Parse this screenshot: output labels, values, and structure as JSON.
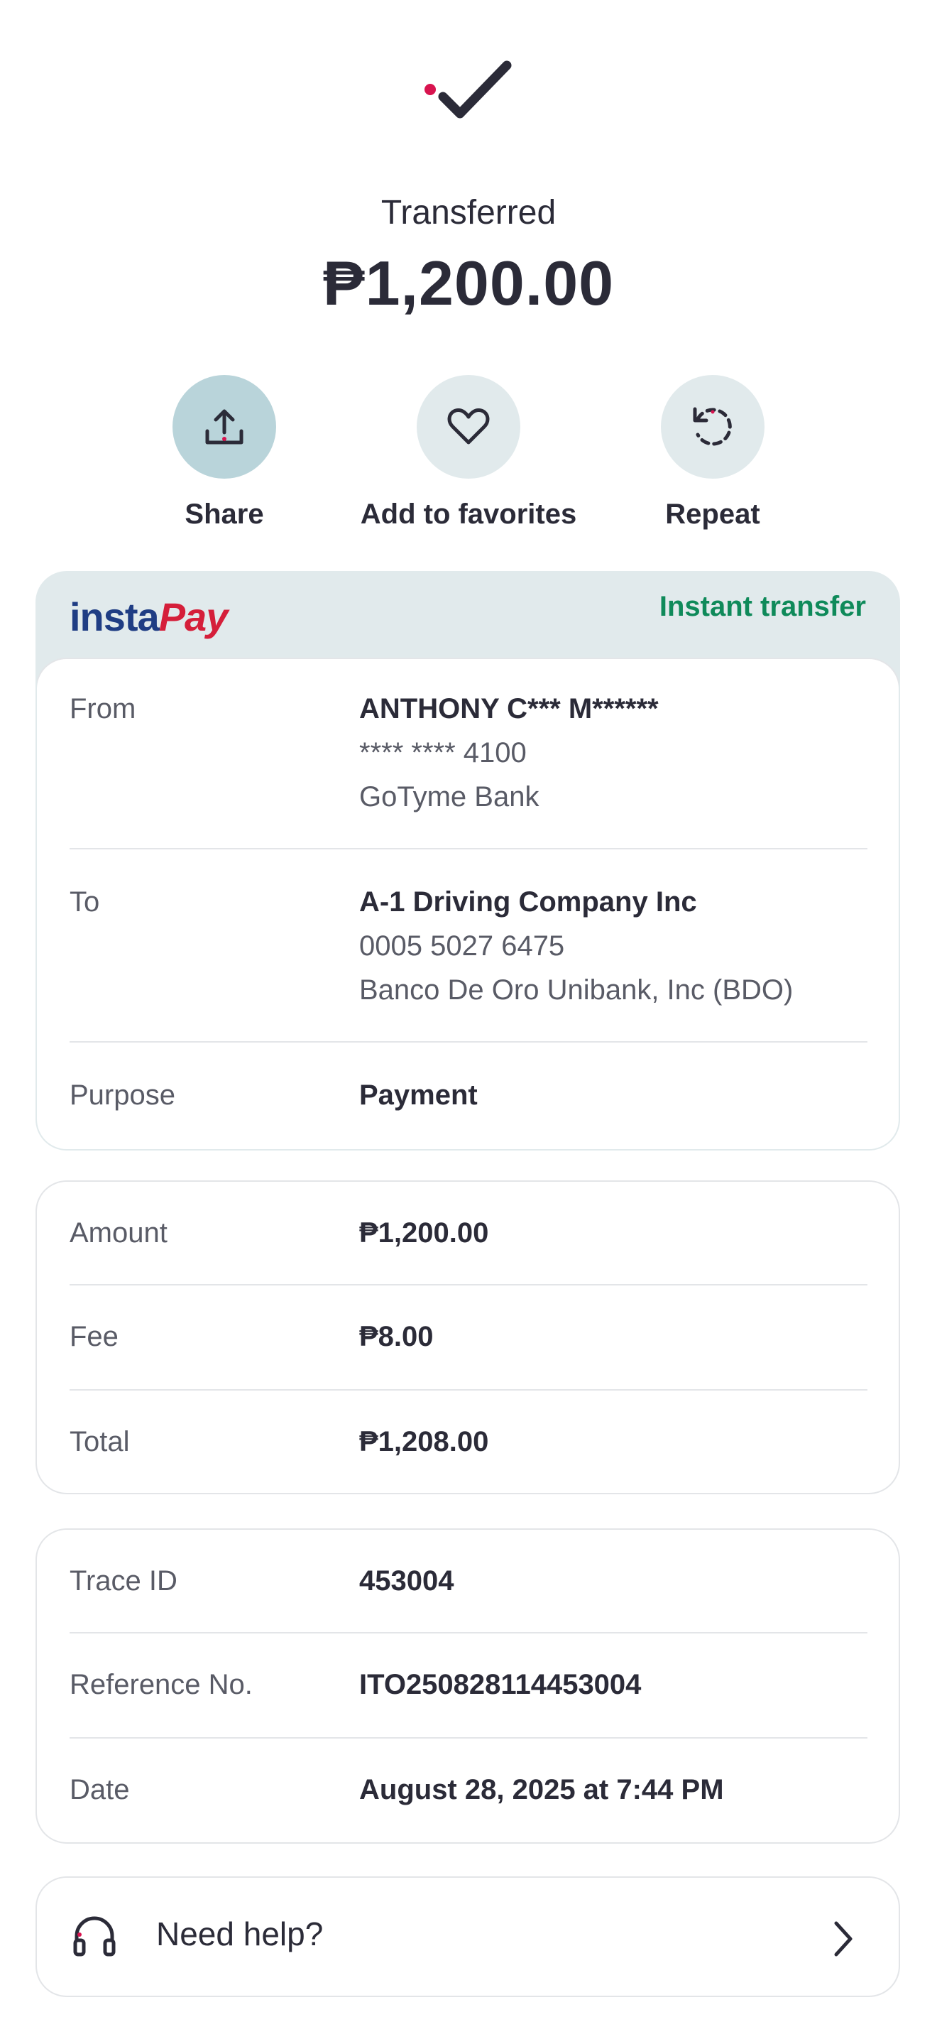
{
  "header": {
    "status_label": "Transferred",
    "amount": "₱1,200.00"
  },
  "actions": [
    {
      "label": "Share",
      "icon": "share-icon"
    },
    {
      "label": "Add to favorites",
      "icon": "heart-icon"
    },
    {
      "label": "Repeat",
      "icon": "repeat-icon"
    }
  ],
  "transfer_card": {
    "brand_part1": "insta",
    "brand_part2": "Pay",
    "tag": "Instant transfer",
    "from": {
      "label": "From",
      "name": "ANTHONY C*** M******",
      "account": "**** **** 4100",
      "bank": "GoTyme Bank"
    },
    "to": {
      "label": "To",
      "name": "A-1 Driving Company Inc",
      "account": "0005 5027 6475",
      "bank": "Banco De Oro Unibank, Inc (BDO)"
    },
    "purpose": {
      "label": "Purpose",
      "value": "Payment"
    }
  },
  "amount_card": {
    "amount": {
      "label": "Amount",
      "value": "₱1,200.00"
    },
    "fee": {
      "label": "Fee",
      "value": "₱8.00"
    },
    "total": {
      "label": "Total",
      "value": "₱1,208.00"
    }
  },
  "trace_card": {
    "trace_id": {
      "label": "Trace ID",
      "value": "453004"
    },
    "reference": {
      "label": "Reference No.",
      "value": "ITO250828114453004"
    },
    "date": {
      "label": "Date",
      "value": "August 28, 2025 at 7:44 PM"
    }
  },
  "help": {
    "label": "Need help?"
  },
  "colors": {
    "accent_pink": "#d8144f",
    "dark": "#2b2b38",
    "green": "#0f8a5a",
    "share_bg": "#b9d4da",
    "light_bg": "#e1eaec"
  }
}
